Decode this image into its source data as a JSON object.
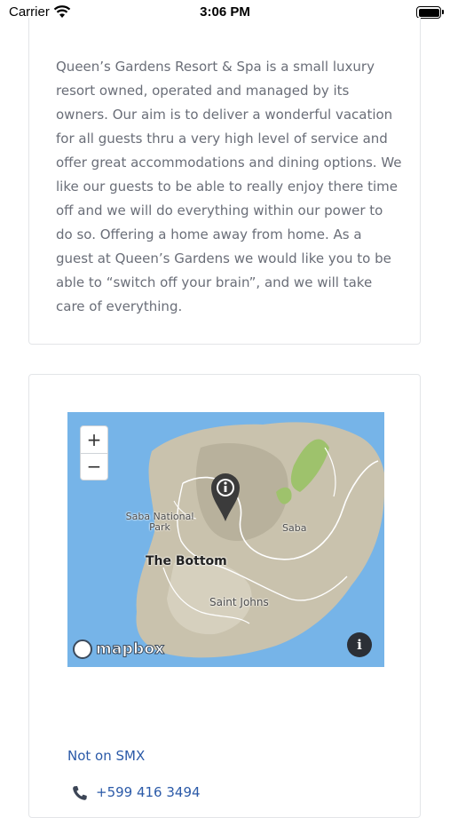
{
  "status_bar": {
    "carrier": "Carrier",
    "time": "3:06 PM",
    "wifi_icon": "wifi-icon",
    "battery_icon": "battery-icon"
  },
  "description": "Queen’s Gardens Resort & Spa is a small luxury resort owned, operated and managed by its owners. Our aim is to deliver a wonderful vacation for all guests thru a very high level of service and offer great accommodations and dining options. We like our guests to be able to really enjoy there time off and we will do everything within our power to do so. Offering a home away from home. As a guest at Queen’s Gardens we would like you to be able to “switch off your brain”, and we will take care of everything.",
  "map": {
    "zoom_in": "+",
    "zoom_out": "−",
    "labels": {
      "park": "Saba National Park",
      "park_line1": "Saba National",
      "park_line2": "Park",
      "the_bottom": "The Bottom",
      "saba": "Saba",
      "saint_johns": "Saint Johns"
    },
    "attribution_logo": "mapbox",
    "info_button": "i",
    "marker_icon": "info-marker-icon"
  },
  "location_note": "Not on SMX",
  "phone": "+599 416 3494",
  "colors": {
    "link": "#2b5aa8",
    "body_text": "#6a6e78",
    "water": "#76b4e8",
    "land": "#c9c2ad"
  }
}
